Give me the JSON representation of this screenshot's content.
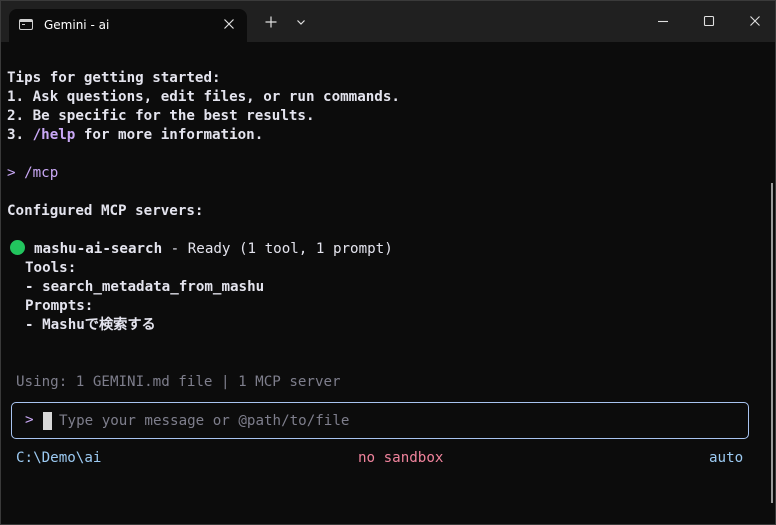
{
  "window": {
    "tab_title": "Gemini - ai"
  },
  "terminal": {
    "tips_heading": "Tips for getting started:",
    "tip1": "1. Ask questions, edit files, or run commands.",
    "tip2": "2. Be specific for the best results.",
    "tip3_number": "3. ",
    "tip3_command": "/help",
    "tip3_rest": " for more information.",
    "command_prompt": "> /mcp",
    "configured_heading": "Configured MCP servers:",
    "server_name": "mashu-ai-search",
    "server_status": " - Ready (1 tool, 1 prompt)",
    "tools_label": "Tools:",
    "tool_item": "- search_metadata_from_mashu",
    "prompts_label": "Prompts:",
    "prompt_item": "- Mashuで検索する",
    "usage_summary": "Using: 1 GEMINI.md file | 1 MCP server",
    "input_prompt": ">",
    "input_placeholder": "Type your message or @path/to/file",
    "input_value": "",
    "cwd": "C:\\Demo\\ai",
    "sandbox": "no sandbox",
    "model": "auto"
  },
  "colors": {
    "background": "#0c0c0c",
    "titlebar": "#202020",
    "status_ready": "#22c55e",
    "accent_purple": "#c9a8f5",
    "input_border": "#a8c4f0",
    "cwd_blue": "#9ccaf2",
    "sandbox_pink": "#f0839c"
  },
  "icons": {
    "tab": "terminal-icon",
    "tab_close": "close-icon",
    "new_tab": "plus-icon",
    "dropdown": "chevron-down-icon",
    "minimize": "minimize-icon",
    "maximize": "maximize-icon",
    "close": "close-icon"
  }
}
